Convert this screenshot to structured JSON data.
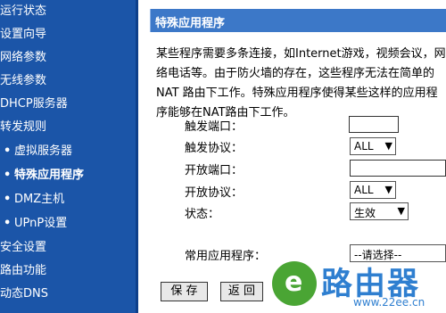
{
  "sidebar": {
    "items": [
      {
        "label": "运行状态",
        "bullet": ""
      },
      {
        "label": "设置向导",
        "bullet": ""
      },
      {
        "label": "网络参数",
        "bullet": ""
      },
      {
        "label": "无线参数",
        "bullet": ""
      },
      {
        "label": "DHCP服务器",
        "bullet": ""
      },
      {
        "label": "转发规则",
        "bullet": ""
      },
      {
        "label": "虚拟服务器",
        "bullet": "•"
      },
      {
        "label": "特殊应用程序",
        "bullet": "•"
      },
      {
        "label": "DMZ主机",
        "bullet": "•"
      },
      {
        "label": "UPnP设置",
        "bullet": "•"
      },
      {
        "label": "安全设置",
        "bullet": ""
      },
      {
        "label": "路由功能",
        "bullet": ""
      },
      {
        "label": "动态DNS",
        "bullet": ""
      }
    ]
  },
  "panel": {
    "title": "特殊应用程序",
    "description": "某些程序需要多条连接，如Internet游戏，视频会议，网络电话等。由于防火墙的存在，这些程序无法在简单的NAT 路由下工作。特殊应用程序使得某些这样的应用程序能够在NAT路由下工作。"
  },
  "form": {
    "trigger_port_label": "触发端口：",
    "trigger_port_value": "",
    "trigger_protocol_label": "触发协议：",
    "trigger_protocol_value": "ALL",
    "open_port_label": "开放端口：",
    "open_port_value": "",
    "open_protocol_label": "开放协议：",
    "open_protocol_value": "ALL",
    "status_label": "状态：",
    "status_value": "生效",
    "common_apps_label": "常用应用程序：",
    "common_apps_value": "--请选择--"
  },
  "buttons": {
    "save": "保 存",
    "back": "返 回"
  },
  "watermark": {
    "logo_letter": "e",
    "name": "路由器",
    "url": "www.22ee.cn"
  },
  "colors": {
    "sidebar_bg": "#1b55a8",
    "title_bar": "#3c78c8",
    "watermark_green": "#4aa534",
    "watermark_blue": "#2f7fd0"
  },
  "icons": {
    "dropdown_arrow": "▼"
  }
}
